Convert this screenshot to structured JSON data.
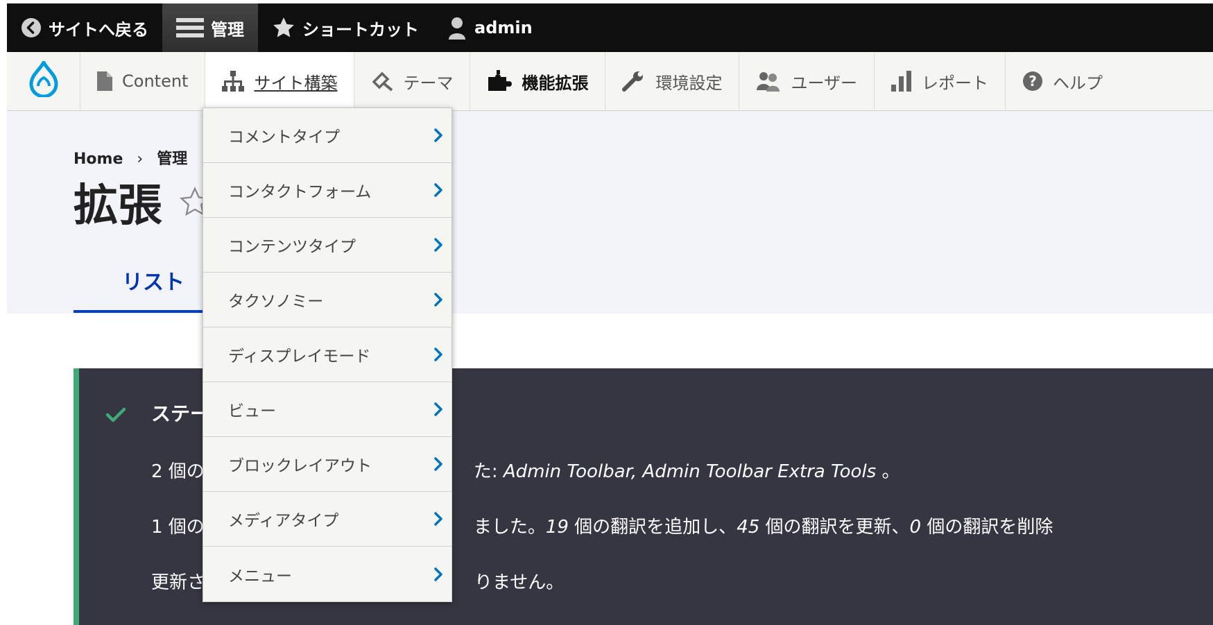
{
  "toolbar": {
    "back_to_site": "サイトへ戻る",
    "manage": "管理",
    "shortcuts": "ショートカット",
    "user": "admin"
  },
  "tray": {
    "items": [
      {
        "label": "Content",
        "icon": "file-icon"
      },
      {
        "label": "サイト構築",
        "icon": "sitemap-icon"
      },
      {
        "label": "テーマ",
        "icon": "paintbrush-icon"
      },
      {
        "label": "機能拡張",
        "icon": "puzzle-icon"
      },
      {
        "label": "環境設定",
        "icon": "wrench-icon"
      },
      {
        "label": "ユーザー",
        "icon": "people-icon"
      },
      {
        "label": "レポート",
        "icon": "bar-chart-icon"
      },
      {
        "label": "ヘルプ",
        "icon": "help-icon"
      }
    ]
  },
  "breadcrumb": {
    "home": "Home",
    "sep": "›",
    "current": "管理"
  },
  "page": {
    "title": "拡張"
  },
  "tabs": {
    "list": "リスト"
  },
  "status": {
    "title": "ステー",
    "line1_a": "2 個の",
    "line1_b": "た: ",
    "line1_italic": "Admin Toolbar, Admin Toolbar Extra Tools",
    "line1_c": " 。",
    "line2_a": "1 個の",
    "line2_b": "ました。",
    "line2_n1": "19",
    "line2_c": " 個の翻訳を追加し、",
    "line2_n2": "45",
    "line2_d": " 個の翻訳を更新、",
    "line2_n3": "0",
    "line2_e": " 個の翻訳を削除",
    "line3_a": "更新さ",
    "line3_b": "りません。"
  },
  "dropdown": {
    "items": [
      "コメントタイプ",
      "コンタクトフォーム",
      "コンテンツタイプ",
      "タクソノミー",
      "ディスプレイモード",
      "ビュー",
      "ブロックレイアウト",
      "メディアタイプ",
      "メニュー"
    ]
  },
  "colors": {
    "toolbar_bg": "#0f0f0f",
    "tray_bg": "#f5f5f2",
    "header_bg": "#f3f4f9",
    "tab_active": "#003ecc",
    "status_bg": "#353641",
    "status_accent": "#42a877",
    "chevron": "#0073ba",
    "drupal_blue": "#009cde"
  }
}
